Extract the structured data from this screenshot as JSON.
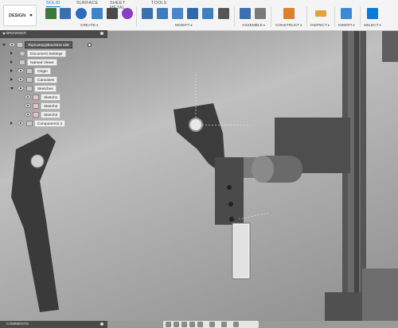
{
  "toolbar": {
    "workspace": "DESIGN",
    "tabs": [
      "SOLID",
      "SURFACE",
      "SHEET METAL",
      "TOOLS"
    ],
    "groups": [
      "CREATE",
      "MODIFY",
      "ASSEMBLE",
      "CONSTRUCT",
      "INSPECT",
      "INSERT",
      "SELECT"
    ]
  },
  "browser": {
    "title": "BROWSER",
    "root": "TopCanopyBoxStrut v26",
    "items": [
      {
        "label": "Document Settings"
      },
      {
        "label": "Named Views"
      },
      {
        "label": "Origin"
      },
      {
        "label": "Canvases"
      },
      {
        "label": "Sketches"
      },
      {
        "label": "Sketch1"
      },
      {
        "label": "Sketch2"
      },
      {
        "label": "Sketch3"
      },
      {
        "label": "Component1:1"
      }
    ]
  },
  "comments": {
    "title": "COMMENTS"
  },
  "colors": {
    "accent": "#0a7bd6",
    "panel_header": "#4a4a4a",
    "toolbar_bg": "#f4f4f4"
  }
}
